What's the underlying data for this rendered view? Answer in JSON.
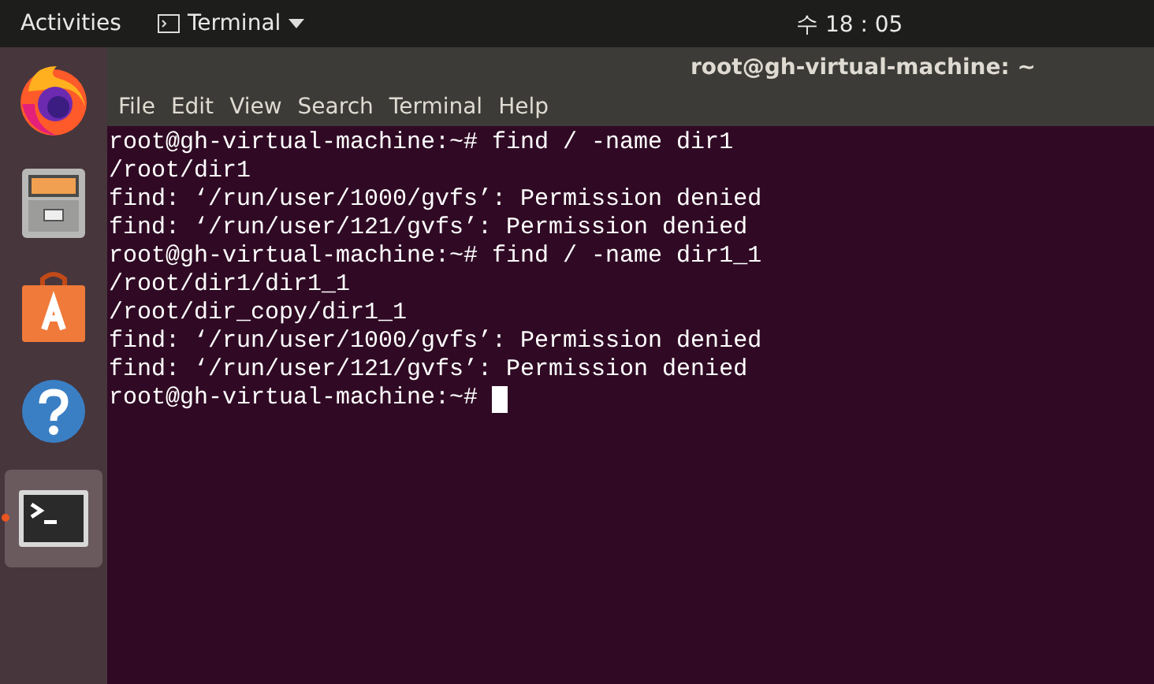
{
  "top_bar": {
    "activities": "Activities",
    "app_menu": "Terminal",
    "clock": "수 18 : 05"
  },
  "dock": [
    {
      "kind": "firefox",
      "selected": false,
      "running": false
    },
    {
      "kind": "files",
      "selected": false,
      "running": false
    },
    {
      "kind": "software",
      "selected": false,
      "running": false
    },
    {
      "kind": "help",
      "selected": false,
      "running": false
    },
    {
      "kind": "terminal",
      "selected": true,
      "running": true
    }
  ],
  "window": {
    "title": "root@gh-virtual-machine: ~",
    "menu": [
      "File",
      "Edit",
      "View",
      "Search",
      "Terminal",
      "Help"
    ],
    "lines": [
      "root@gh-virtual-machine:~# find / -name dir1",
      "/root/dir1",
      "find: ‘/run/user/1000/gvfs’: Permission denied",
      "find: ‘/run/user/121/gvfs’: Permission denied",
      "root@gh-virtual-machine:~# find / -name dir1_1",
      "/root/dir1/dir1_1",
      "/root/dir_copy/dir1_1",
      "find: ‘/run/user/1000/gvfs’: Permission denied",
      "find: ‘/run/user/121/gvfs’: Permission denied",
      "root@gh-virtual-machine:~# "
    ],
    "cursor": true
  }
}
